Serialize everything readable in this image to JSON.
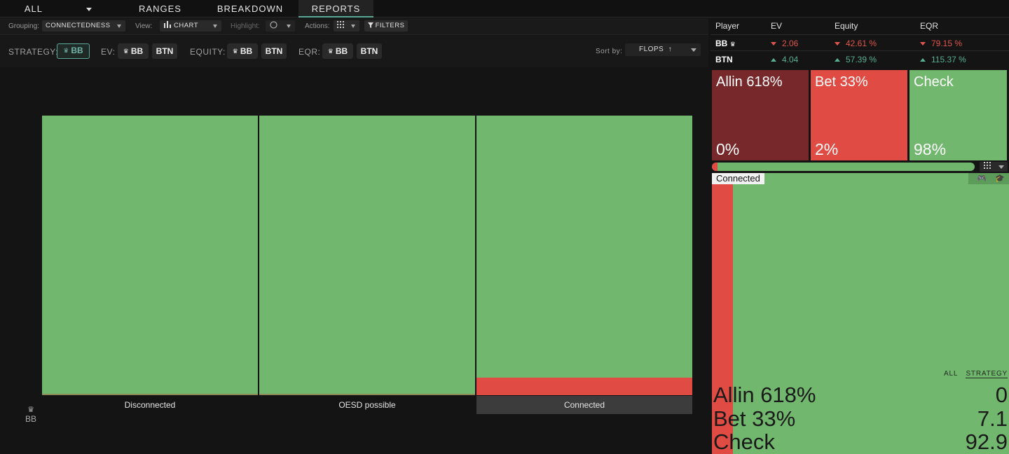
{
  "nav": {
    "tabs": [
      {
        "label": "ALL"
      },
      {
        "label": "RANGES"
      },
      {
        "label": "BREAKDOWN"
      },
      {
        "label": "REPORTS"
      }
    ]
  },
  "toolbar": {
    "grouping_label": "Grouping:",
    "grouping_value": "CONNECTEDNESS",
    "view_label": "View:",
    "view_value": "CHART",
    "highlight_label": "Highlight:",
    "actions_label": "Actions:",
    "filters_label": "FILTERS"
  },
  "stratbar": {
    "strategy_label": "STRATEGY:",
    "ev_label": "EV:",
    "equity_label": "EQUITY:",
    "eqr_label": "EQR:",
    "bb": "BB",
    "btn": "BTN",
    "sort_label": "Sort by:",
    "sort_value": "FLOPS"
  },
  "chart": {
    "axis_player": "BB",
    "columns": [
      {
        "label": "Disconnected",
        "check": 99.5,
        "bet": 0.5,
        "active": false
      },
      {
        "label": "OESD possible",
        "check": 99.5,
        "bet": 0.5,
        "active": false
      },
      {
        "label": "Connected",
        "check": 92.9,
        "bet": 7.1,
        "active": true
      }
    ]
  },
  "stats": {
    "headers": [
      "Player",
      "EV",
      "Equity",
      "EQR"
    ],
    "rows": [
      {
        "player": "BB",
        "ev": "2.06",
        "equity": "42.61 %",
        "eqr": "79.15 %"
      },
      {
        "player": "BTN",
        "ev": "4.04",
        "equity": "57.39 %",
        "eqr": "115.37 %"
      }
    ]
  },
  "actions": [
    {
      "name": "Allin 618%",
      "pct": "0%",
      "color": "#77282a"
    },
    {
      "name": "Bet 33%",
      "pct": "2%",
      "color": "#e04b43"
    },
    {
      "name": "Check",
      "pct": "98%",
      "color": "#71b76e"
    }
  ],
  "progress": {
    "bet_fraction": 0.02
  },
  "detail": {
    "tag": "Connected",
    "tab_all": "ALL",
    "tab_strategy": "STRATEGY",
    "rows": [
      {
        "name": "Allin 618%",
        "value": "0"
      },
      {
        "name": "Bet 33%",
        "value": "7.1"
      },
      {
        "name": "Check",
        "value": "92.9"
      }
    ]
  }
}
